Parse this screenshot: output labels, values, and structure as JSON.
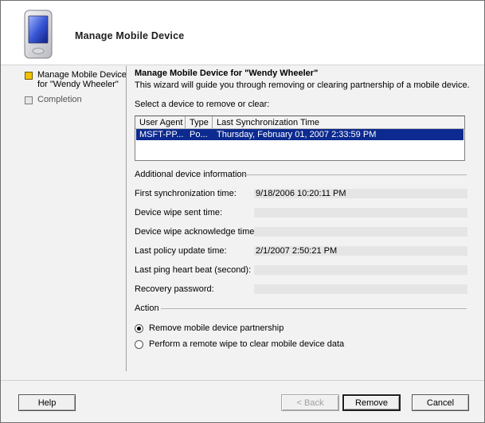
{
  "header": {
    "title": "Manage Mobile Device"
  },
  "steps": [
    {
      "label": "Manage Mobile Device for \"Wendy Wheeler\""
    },
    {
      "label": "Completion"
    }
  ],
  "main": {
    "title": "Manage Mobile Device for \"Wendy Wheeler\"",
    "description": "This wizard will guide you through removing or clearing partnership of a mobile device.",
    "list_label": "Select a device to remove or clear:",
    "columns": [
      "User Agent",
      "Type",
      "Last Synchronization Time"
    ],
    "rows": [
      {
        "user_agent": "MSFT-PP...",
        "type": "Po...",
        "last_sync": "Thursday, February 01, 2007 2:33:59 PM"
      }
    ]
  },
  "info": {
    "section_title": "Additional device information",
    "fields": [
      {
        "label": "First synchronization time:",
        "value": "9/18/2006 10:20:11 PM"
      },
      {
        "label": "Device wipe sent time:",
        "value": ""
      },
      {
        "label": "Device wipe acknowledge time:",
        "value": ""
      },
      {
        "label": "Last policy update time:",
        "value": "2/1/2007 2:50:21 PM"
      },
      {
        "label": "Last ping heart beat (second):",
        "value": ""
      },
      {
        "label": "Recovery password:",
        "value": ""
      }
    ]
  },
  "action": {
    "section_title": "Action",
    "options": [
      {
        "label": "Remove mobile device partnership",
        "checked": true
      },
      {
        "label": "Perform a remote wipe to clear mobile device data",
        "checked": false
      }
    ]
  },
  "buttons": {
    "help": "Help",
    "back": "< Back",
    "remove": "Remove",
    "cancel": "Cancel"
  },
  "colors": {
    "selection": "#0c2a8f",
    "active_step": "#f2c200"
  }
}
